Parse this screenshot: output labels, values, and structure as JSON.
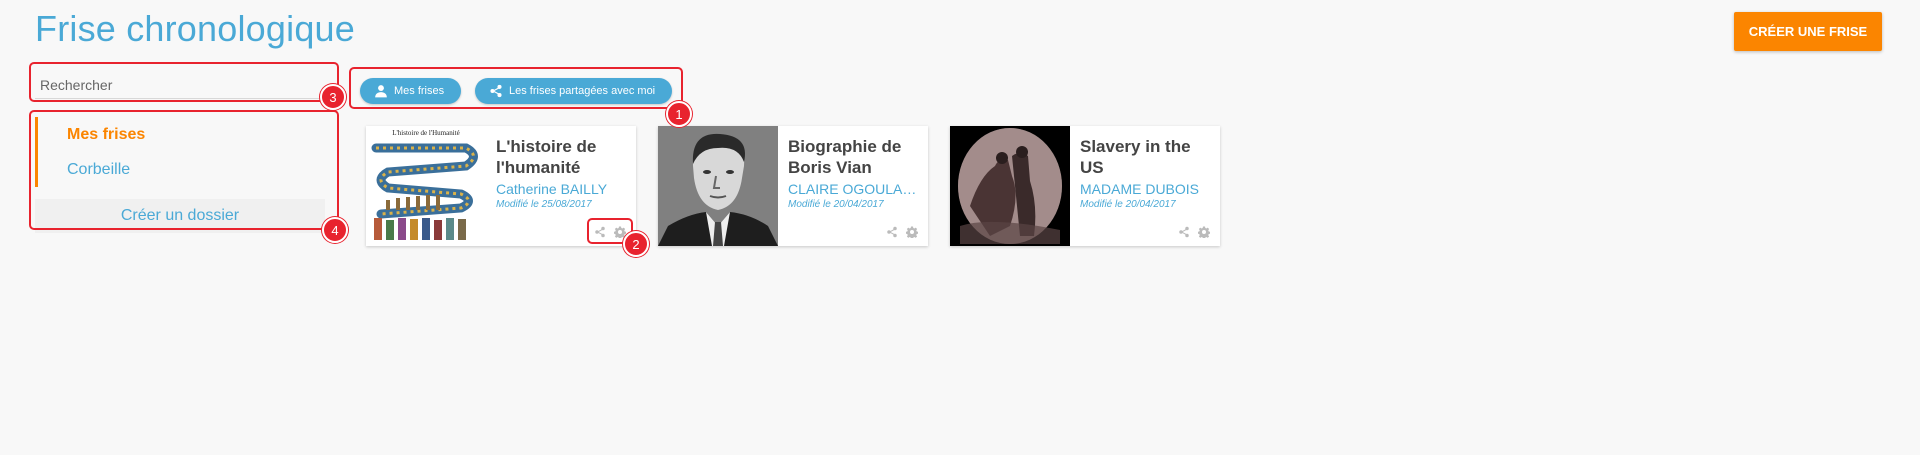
{
  "header": {
    "title": "Frise chronologique",
    "create_label": "CRÉER UNE FRISE"
  },
  "search": {
    "placeholder": "Rechercher"
  },
  "tabs": [
    {
      "label": "Mes frises",
      "icon": "user-icon"
    },
    {
      "label": "Les frises partagées avec moi",
      "icon": "share-icon"
    }
  ],
  "sidebar": {
    "items": [
      {
        "label": "Mes frises",
        "active": true
      },
      {
        "label": "Corbeille",
        "active": false
      }
    ],
    "new_folder_label": "Créer un dossier"
  },
  "cards": [
    {
      "title": "L'histoire de l'humanité",
      "author": "Catherine BAILLY",
      "date": "Modifié le 25/08/2017",
      "thumb_caption": "L'histoire de l'Humanité"
    },
    {
      "title": "Biographie de Boris Vian",
      "author": "CLAIRE OGOULA-N...",
      "date": "Modifié le 20/04/2017"
    },
    {
      "title": "Slavery in the US",
      "author": "MADAME DUBOIS",
      "date": "Modifié le 20/04/2017"
    }
  ],
  "annotations": [
    "1",
    "2",
    "3",
    "4"
  ],
  "colors": {
    "accent": "#4aa9d6",
    "orange": "#fb8500",
    "annotation": "#e8232e"
  }
}
